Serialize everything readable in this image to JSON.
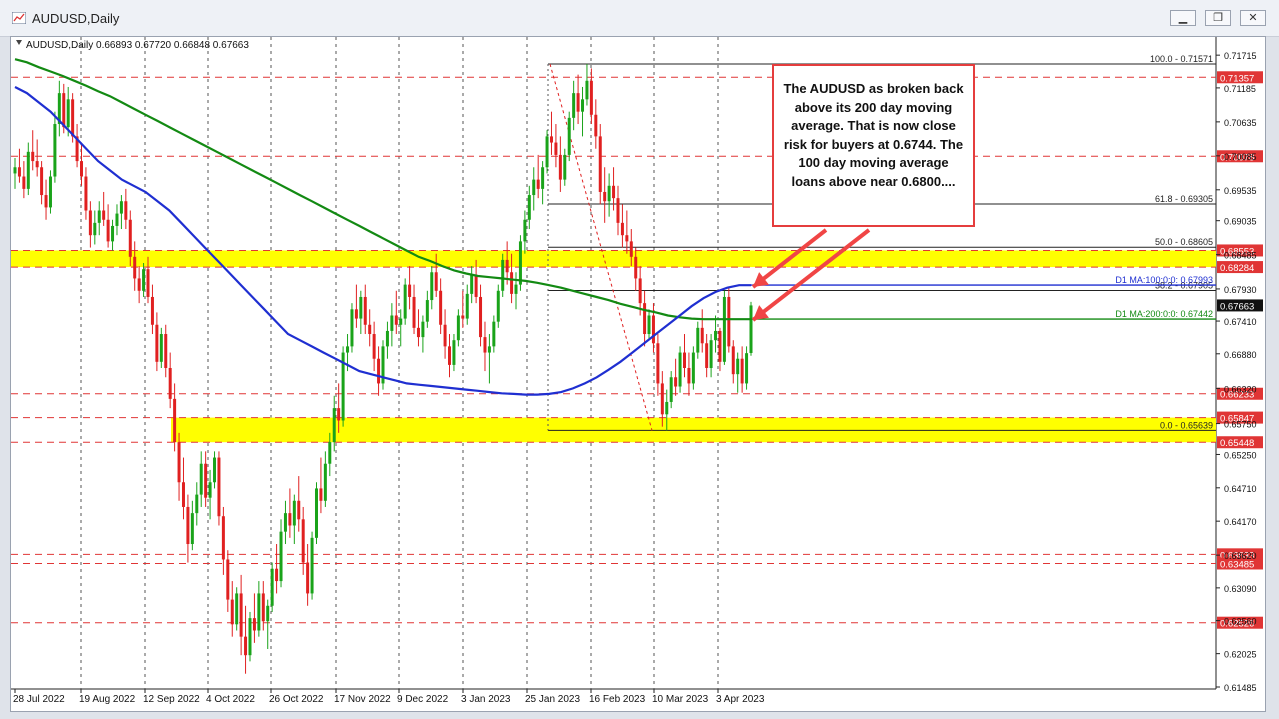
{
  "window": {
    "title": "AUDUSD,Daily",
    "buttons": [
      "minimize",
      "restore",
      "close"
    ]
  },
  "chart_header": {
    "text": "AUDUSD,Daily  0.66893 0.67720 0.66848 0.67663"
  },
  "annotation": {
    "text": "The AUDUSD as broken back above its 200 day moving average. That is now close risk for buyers at 0.6744. The 100 day moving average loans above near 0.6800...."
  },
  "chart_data": {
    "type": "candlestick",
    "symbol": "AUDUSD",
    "timeframe": "Daily",
    "ohlc_last": {
      "open": 0.66893,
      "high": 0.6772,
      "low": 0.66848,
      "close": 0.67663
    },
    "current_price_label": "0.67663",
    "ylim": [
      0.61485,
      0.7175
    ],
    "x_tick_labels": [
      "28 Jul 2022",
      "19 Aug 2022",
      "12 Sep 2022",
      "4 Oct 2022",
      "26 Oct 2022",
      "17 Nov 2022",
      "9 Dec 2022",
      "3 Jan 2023",
      "25 Jan 2023",
      "16 Feb 2023",
      "10 Mar 2023",
      "3 Apr 2023"
    ],
    "y_tick_labels": [
      "0.71715",
      "0.71185",
      "0.70635",
      "0.70085",
      "0.69535",
      "0.69035",
      "0.68485",
      "0.67930",
      "0.67410",
      "0.66880",
      "0.66320",
      "0.65750",
      "0.65250",
      "0.64710",
      "0.64170",
      "0.63620",
      "0.63090",
      "0.62560",
      "0.62025",
      "0.61485"
    ],
    "y_tick_values": [
      0.71715,
      0.71185,
      0.70635,
      0.70085,
      0.69535,
      0.69035,
      0.68485,
      0.6793,
      0.6741,
      0.6688,
      0.6632,
      0.6575,
      0.6525,
      0.6471,
      0.6417,
      0.6362,
      0.6309,
      0.6256,
      0.62025,
      0.61485
    ],
    "red_levels": [
      "0.71357",
      "0.70078",
      "0.68553",
      "0.68284",
      "0.66233",
      "0.65847",
      "0.65448",
      "0.63633",
      "0.63485",
      "0.62526"
    ],
    "red_level_values": [
      0.71357,
      0.70078,
      0.68553,
      0.68284,
      0.66233,
      0.65847,
      0.65448,
      0.63633,
      0.63485,
      0.62526
    ],
    "support_resistance_zones": [
      [
        0.68284,
        0.68553
      ],
      [
        0.65448,
        0.65847
      ]
    ],
    "fibonacci": [
      {
        "label": "100.0 - 0.71571",
        "value": 0.71571
      },
      {
        "label": "61.8 - 0.69305",
        "value": 0.69305
      },
      {
        "label": "50.0 - 0.68605",
        "value": 0.68605
      },
      {
        "label": "38.2 - 0.67905",
        "value": 0.67905
      },
      {
        "label": "0.0 - 0.65639",
        "value": 0.65639
      }
    ],
    "moving_averages": [
      {
        "label": "D1 MA:100:0:0: 0.67993",
        "value": 0.67993,
        "color": "#1f2fd1"
      },
      {
        "label": "D1 MA:200:0:0: 0.67442",
        "value": 0.67442,
        "color": "#138a13"
      }
    ],
    "colors": {
      "bull": "#1aa31a",
      "bear": "#e02020",
      "ma100": "#1f2fd1",
      "ma200": "#138a13",
      "level": "#e03535",
      "zone": "#ffff00",
      "price_box": "#d42020"
    },
    "candles": [
      [
        0.698,
        0.7005,
        0.6955,
        0.699
      ],
      [
        0.699,
        0.702,
        0.6965,
        0.6975
      ],
      [
        0.6975,
        0.7,
        0.694,
        0.6955
      ],
      [
        0.6955,
        0.703,
        0.6945,
        0.7015
      ],
      [
        0.7015,
        0.705,
        0.6985,
        0.7
      ],
      [
        0.7,
        0.7035,
        0.6975,
        0.699
      ],
      [
        0.699,
        0.7,
        0.693,
        0.6945
      ],
      [
        0.6945,
        0.697,
        0.6905,
        0.6925
      ],
      [
        0.6925,
        0.6985,
        0.6915,
        0.6975
      ],
      [
        0.6975,
        0.708,
        0.6965,
        0.706
      ],
      [
        0.706,
        0.713,
        0.704,
        0.711
      ],
      [
        0.711,
        0.7125,
        0.7045,
        0.7055
      ],
      [
        0.7055,
        0.712,
        0.704,
        0.71
      ],
      [
        0.71,
        0.711,
        0.703,
        0.704
      ],
      [
        0.704,
        0.706,
        0.699,
        0.7
      ],
      [
        0.7,
        0.703,
        0.696,
        0.6975
      ],
      [
        0.6975,
        0.699,
        0.6905,
        0.692
      ],
      [
        0.692,
        0.6935,
        0.686,
        0.688
      ],
      [
        0.688,
        0.692,
        0.6865,
        0.69
      ],
      [
        0.69,
        0.6935,
        0.688,
        0.692
      ],
      [
        0.692,
        0.695,
        0.6895,
        0.6905
      ],
      [
        0.6905,
        0.693,
        0.686,
        0.687
      ],
      [
        0.687,
        0.6905,
        0.6855,
        0.6895
      ],
      [
        0.6895,
        0.693,
        0.688,
        0.6915
      ],
      [
        0.6915,
        0.6945,
        0.689,
        0.6935
      ],
      [
        0.6935,
        0.6955,
        0.689,
        0.6905
      ],
      [
        0.6905,
        0.692,
        0.683,
        0.6845
      ],
      [
        0.6845,
        0.687,
        0.679,
        0.681
      ],
      [
        0.681,
        0.683,
        0.677,
        0.679
      ],
      [
        0.679,
        0.6835,
        0.678,
        0.6825
      ],
      [
        0.6825,
        0.6845,
        0.677,
        0.678
      ],
      [
        0.678,
        0.68,
        0.672,
        0.6735
      ],
      [
        0.6735,
        0.6755,
        0.666,
        0.6675
      ],
      [
        0.6675,
        0.673,
        0.6665,
        0.672
      ],
      [
        0.672,
        0.6735,
        0.665,
        0.6665
      ],
      [
        0.6665,
        0.669,
        0.66,
        0.6615
      ],
      [
        0.6615,
        0.664,
        0.653,
        0.6545
      ],
      [
        0.6545,
        0.656,
        0.645,
        0.648
      ],
      [
        0.648,
        0.652,
        0.642,
        0.644
      ],
      [
        0.644,
        0.646,
        0.635,
        0.638
      ],
      [
        0.638,
        0.645,
        0.637,
        0.643
      ],
      [
        0.643,
        0.648,
        0.641,
        0.646
      ],
      [
        0.646,
        0.653,
        0.644,
        0.651
      ],
      [
        0.651,
        0.653,
        0.644,
        0.6455
      ],
      [
        0.6455,
        0.65,
        0.642,
        0.648
      ],
      [
        0.648,
        0.653,
        0.647,
        0.652
      ],
      [
        0.652,
        0.653,
        0.641,
        0.6425
      ],
      [
        0.6425,
        0.644,
        0.633,
        0.6355
      ],
      [
        0.6355,
        0.637,
        0.627,
        0.629
      ],
      [
        0.629,
        0.632,
        0.623,
        0.625
      ],
      [
        0.625,
        0.631,
        0.624,
        0.63
      ],
      [
        0.63,
        0.633,
        0.62,
        0.623
      ],
      [
        0.623,
        0.628,
        0.617,
        0.62
      ],
      [
        0.62,
        0.627,
        0.619,
        0.626
      ],
      [
        0.626,
        0.63,
        0.622,
        0.624
      ],
      [
        0.624,
        0.632,
        0.623,
        0.63
      ],
      [
        0.63,
        0.632,
        0.624,
        0.6255
      ],
      [
        0.6255,
        0.629,
        0.621,
        0.628
      ],
      [
        0.628,
        0.635,
        0.627,
        0.634
      ],
      [
        0.634,
        0.638,
        0.63,
        0.632
      ],
      [
        0.632,
        0.642,
        0.631,
        0.64
      ],
      [
        0.64,
        0.645,
        0.638,
        0.643
      ],
      [
        0.643,
        0.647,
        0.639,
        0.641
      ],
      [
        0.641,
        0.646,
        0.638,
        0.645
      ],
      [
        0.645,
        0.649,
        0.64,
        0.642
      ],
      [
        0.642,
        0.644,
        0.633,
        0.635
      ],
      [
        0.635,
        0.638,
        0.628,
        0.63
      ],
      [
        0.63,
        0.64,
        0.629,
        0.639
      ],
      [
        0.639,
        0.648,
        0.638,
        0.647
      ],
      [
        0.647,
        0.652,
        0.643,
        0.645
      ],
      [
        0.645,
        0.653,
        0.644,
        0.651
      ],
      [
        0.651,
        0.656,
        0.649,
        0.6545
      ],
      [
        0.6545,
        0.662,
        0.653,
        0.66
      ],
      [
        0.66,
        0.664,
        0.656,
        0.658
      ],
      [
        0.658,
        0.67,
        0.657,
        0.669
      ],
      [
        0.669,
        0.672,
        0.666,
        0.67
      ],
      [
        0.67,
        0.677,
        0.669,
        0.676
      ],
      [
        0.676,
        0.68,
        0.673,
        0.6745
      ],
      [
        0.6745,
        0.679,
        0.672,
        0.678
      ],
      [
        0.678,
        0.68,
        0.672,
        0.6735
      ],
      [
        0.6735,
        0.676,
        0.67,
        0.672
      ],
      [
        0.672,
        0.674,
        0.666,
        0.668
      ],
      [
        0.668,
        0.67,
        0.662,
        0.664
      ],
      [
        0.664,
        0.671,
        0.663,
        0.67
      ],
      [
        0.67,
        0.674,
        0.668,
        0.6725
      ],
      [
        0.6725,
        0.677,
        0.67,
        0.675
      ],
      [
        0.675,
        0.679,
        0.672,
        0.6735
      ],
      [
        0.6735,
        0.676,
        0.67,
        0.6745
      ],
      [
        0.6745,
        0.681,
        0.6735,
        0.68
      ],
      [
        0.68,
        0.683,
        0.676,
        0.678
      ],
      [
        0.678,
        0.68,
        0.672,
        0.673
      ],
      [
        0.673,
        0.676,
        0.67,
        0.6715
      ],
      [
        0.6715,
        0.675,
        0.669,
        0.674
      ],
      [
        0.674,
        0.679,
        0.673,
        0.6775
      ],
      [
        0.6775,
        0.683,
        0.676,
        0.682
      ],
      [
        0.682,
        0.685,
        0.678,
        0.679
      ],
      [
        0.679,
        0.681,
        0.672,
        0.6735
      ],
      [
        0.6735,
        0.676,
        0.668,
        0.67
      ],
      [
        0.67,
        0.672,
        0.665,
        0.667
      ],
      [
        0.667,
        0.672,
        0.666,
        0.671
      ],
      [
        0.671,
        0.676,
        0.67,
        0.675
      ],
      [
        0.675,
        0.679,
        0.673,
        0.6745
      ],
      [
        0.6745,
        0.68,
        0.6735,
        0.6785
      ],
      [
        0.6785,
        0.683,
        0.677,
        0.6815
      ],
      [
        0.6815,
        0.684,
        0.677,
        0.678
      ],
      [
        0.678,
        0.68,
        0.67,
        0.6715
      ],
      [
        0.6715,
        0.674,
        0.666,
        0.669
      ],
      [
        0.669,
        0.672,
        0.664,
        0.67
      ],
      [
        0.67,
        0.675,
        0.669,
        0.674
      ],
      [
        0.674,
        0.68,
        0.673,
        0.679
      ],
      [
        0.679,
        0.685,
        0.678,
        0.684
      ],
      [
        0.684,
        0.687,
        0.68,
        0.682
      ],
      [
        0.682,
        0.685,
        0.677,
        0.6785
      ],
      [
        0.6785,
        0.682,
        0.676,
        0.68
      ],
      [
        0.68,
        0.688,
        0.679,
        0.687
      ],
      [
        0.687,
        0.692,
        0.685,
        0.6905
      ],
      [
        0.6905,
        0.696,
        0.689,
        0.6945
      ],
      [
        0.6945,
        0.699,
        0.692,
        0.697
      ],
      [
        0.697,
        0.701,
        0.694,
        0.6955
      ],
      [
        0.6955,
        0.7,
        0.693,
        0.699
      ],
      [
        0.699,
        0.705,
        0.698,
        0.704
      ],
      [
        0.704,
        0.708,
        0.701,
        0.703
      ],
      [
        0.703,
        0.706,
        0.699,
        0.701
      ],
      [
        0.701,
        0.704,
        0.695,
        0.697
      ],
      [
        0.697,
        0.702,
        0.696,
        0.701
      ],
      [
        0.701,
        0.708,
        0.7,
        0.707
      ],
      [
        0.707,
        0.713,
        0.705,
        0.711
      ],
      [
        0.711,
        0.714,
        0.706,
        0.708
      ],
      [
        0.708,
        0.712,
        0.704,
        0.71
      ],
      [
        0.71,
        0.7157,
        0.709,
        0.713
      ],
      [
        0.713,
        0.715,
        0.706,
        0.7075
      ],
      [
        0.7075,
        0.71,
        0.702,
        0.704
      ],
      [
        0.704,
        0.706,
        0.693,
        0.695
      ],
      [
        0.695,
        0.699,
        0.69,
        0.6935
      ],
      [
        0.6935,
        0.698,
        0.691,
        0.696
      ],
      [
        0.696,
        0.699,
        0.692,
        0.694
      ],
      [
        0.694,
        0.696,
        0.688,
        0.69
      ],
      [
        0.69,
        0.693,
        0.686,
        0.688
      ],
      [
        0.688,
        0.692,
        0.685,
        0.687
      ],
      [
        0.687,
        0.689,
        0.683,
        0.6845
      ],
      [
        0.6845,
        0.686,
        0.679,
        0.681
      ],
      [
        0.681,
        0.683,
        0.675,
        0.677
      ],
      [
        0.677,
        0.679,
        0.67,
        0.672
      ],
      [
        0.672,
        0.676,
        0.671,
        0.675
      ],
      [
        0.675,
        0.677,
        0.669,
        0.6705
      ],
      [
        0.6705,
        0.672,
        0.662,
        0.664
      ],
      [
        0.664,
        0.666,
        0.657,
        0.659
      ],
      [
        0.659,
        0.663,
        0.6564,
        0.661
      ],
      [
        0.661,
        0.666,
        0.66,
        0.665
      ],
      [
        0.665,
        0.668,
        0.662,
        0.6635
      ],
      [
        0.6635,
        0.67,
        0.6625,
        0.669
      ],
      [
        0.669,
        0.672,
        0.665,
        0.6665
      ],
      [
        0.6665,
        0.669,
        0.662,
        0.664
      ],
      [
        0.664,
        0.67,
        0.663,
        0.669
      ],
      [
        0.669,
        0.674,
        0.668,
        0.673
      ],
      [
        0.673,
        0.676,
        0.669,
        0.6705
      ],
      [
        0.6705,
        0.672,
        0.665,
        0.6665
      ],
      [
        0.6665,
        0.672,
        0.665,
        0.671
      ],
      [
        0.671,
        0.675,
        0.669,
        0.6725
      ],
      [
        0.6725,
        0.673,
        0.666,
        0.6675
      ],
      [
        0.6675,
        0.679,
        0.667,
        0.678
      ],
      [
        0.678,
        0.6795,
        0.669,
        0.67
      ],
      [
        0.67,
        0.671,
        0.664,
        0.6655
      ],
      [
        0.6655,
        0.669,
        0.6625,
        0.668
      ],
      [
        0.668,
        0.67,
        0.6625,
        0.664
      ],
      [
        0.664,
        0.67,
        0.663,
        0.6689
      ],
      [
        0.66893,
        0.6772,
        0.66848,
        0.67663
      ]
    ],
    "ma100": [
      0.712,
      0.711,
      0.7095,
      0.708,
      0.706,
      0.704,
      0.702,
      0.7,
      0.6985,
      0.697,
      0.696,
      0.695,
      0.6935,
      0.692,
      0.69,
      0.688,
      0.686,
      0.684,
      0.682,
      0.68,
      0.678,
      0.676,
      0.674,
      0.672,
      0.671,
      0.67,
      0.669,
      0.668,
      0.667,
      0.666,
      0.6655,
      0.665,
      0.6645,
      0.664,
      0.6638,
      0.6636,
      0.6634,
      0.6632,
      0.663,
      0.6628,
      0.6626,
      0.6624,
      0.6623,
      0.6622,
      0.6622,
      0.6623,
      0.6626,
      0.6632,
      0.664,
      0.665,
      0.6662,
      0.6675,
      0.669,
      0.6705,
      0.672,
      0.6735,
      0.675,
      0.6765,
      0.6778,
      0.6788,
      0.6795,
      0.6799,
      0.6799
    ],
    "ma200": [
      0.7165,
      0.716,
      0.7152,
      0.7145,
      0.7138,
      0.713,
      0.7122,
      0.7113,
      0.7105,
      0.7095,
      0.7085,
      0.7075,
      0.7065,
      0.7055,
      0.7045,
      0.7035,
      0.7025,
      0.7015,
      0.7005,
      0.6995,
      0.6985,
      0.6975,
      0.6965,
      0.6955,
      0.6945,
      0.6935,
      0.6925,
      0.6915,
      0.6905,
      0.6895,
      0.6885,
      0.6875,
      0.6865,
      0.6855,
      0.6845,
      0.6838,
      0.683,
      0.6823,
      0.6818,
      0.6814,
      0.6812,
      0.681,
      0.6808,
      0.6806,
      0.6803,
      0.6799,
      0.6795,
      0.679,
      0.6785,
      0.678,
      0.6775,
      0.6769,
      0.6764,
      0.6759,
      0.6755,
      0.675,
      0.6747,
      0.6745,
      0.6744,
      0.6744,
      0.6744,
      0.6744,
      0.6744
    ]
  }
}
